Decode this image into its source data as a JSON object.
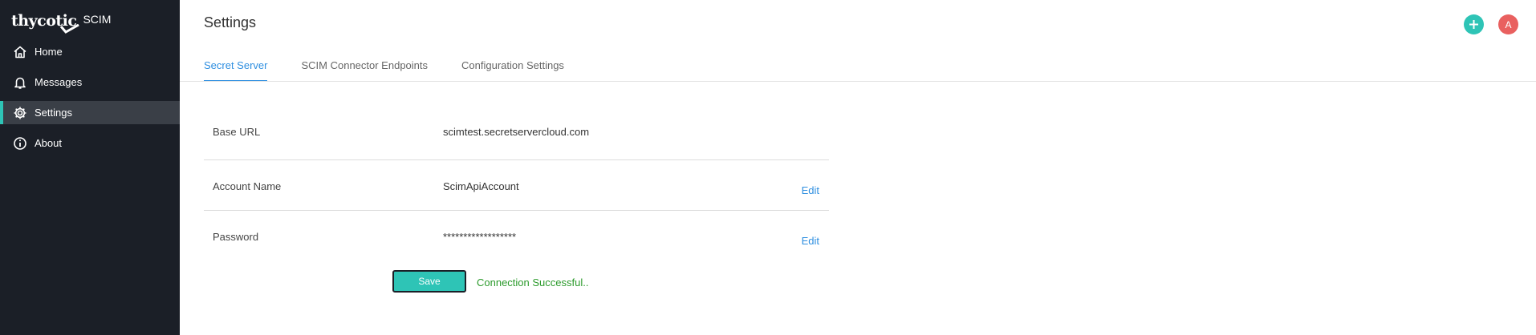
{
  "brand": {
    "logo": "thycotic",
    "product": "SCIM"
  },
  "sidebar": {
    "items": [
      {
        "label": "Home",
        "icon": "home-icon",
        "active": false
      },
      {
        "label": "Messages",
        "icon": "bell-icon",
        "active": false
      },
      {
        "label": "Settings",
        "icon": "gear-icon",
        "active": true
      },
      {
        "label": "About",
        "icon": "info-icon",
        "active": false
      }
    ]
  },
  "header": {
    "title": "Settings",
    "avatar_initial": "A"
  },
  "tabs": [
    {
      "label": "Secret Server",
      "active": true
    },
    {
      "label": "SCIM Connector Endpoints",
      "active": false
    },
    {
      "label": "Configuration Settings",
      "active": false
    }
  ],
  "settings": {
    "rows": [
      {
        "label": "Base URL",
        "value": "scimtest.secretservercloud.com",
        "edit": ""
      },
      {
        "label": "Account Name",
        "value": "ScimApiAccount",
        "edit": "Edit"
      },
      {
        "label": "Password",
        "value": "******************",
        "edit": "Edit"
      }
    ]
  },
  "actions": {
    "save_label": "Save",
    "status": "Connection Successful.."
  },
  "colors": {
    "sidebar_bg": "#1b1f27",
    "accent": "#2ec4b6",
    "link": "#2f8fe0",
    "avatar": "#e9605f",
    "success": "#2b9a2b"
  }
}
